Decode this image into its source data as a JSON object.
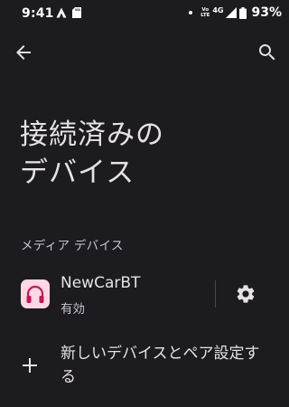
{
  "status_bar": {
    "time": "9:41",
    "left_icons": [
      "app-notification-icon",
      "sd-card-icon"
    ],
    "volte_top": "Vo",
    "volte_bottom": "LTE",
    "network_type": "4G",
    "battery_percent": "93%"
  },
  "toolbar": {
    "back_icon": "arrow-back-icon",
    "search_icon": "search-icon"
  },
  "page": {
    "title_line1": "接続済みの",
    "title_line2": "デバイス"
  },
  "media_section": {
    "header": "メディア デバイス",
    "devices": [
      {
        "name": "NewCarBT",
        "status": "有効",
        "icon": "headphones-icon",
        "icon_tile_color": "#ffd8e4",
        "icon_color": "#c2185b",
        "settings_icon": "gear-icon"
      }
    ]
  },
  "pair_new": {
    "label": "新しいデバイスとペア設定する",
    "icon": "plus-icon"
  }
}
